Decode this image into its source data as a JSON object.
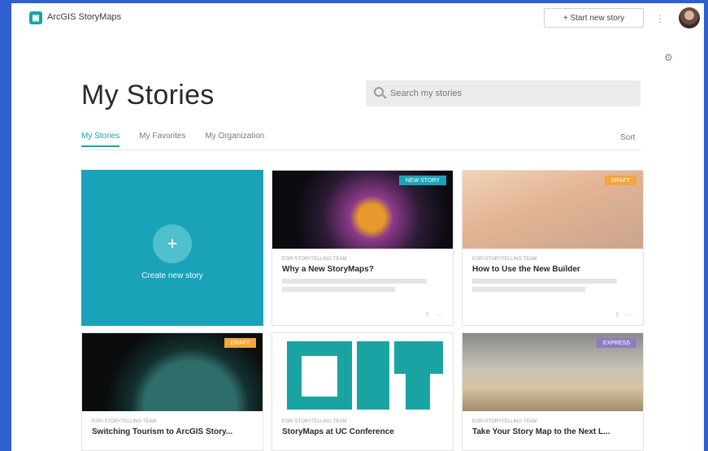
{
  "header": {
    "app_name": "ArcGIS StoryMaps",
    "new_story_label": "+ Start new story",
    "menu_label": "⋮"
  },
  "page": {
    "title": "My Stories",
    "search_placeholder": "Search my stories"
  },
  "tabs": [
    {
      "label": "My Stories",
      "active": true
    },
    {
      "label": "My Favorites",
      "active": false
    },
    {
      "label": "My Organization",
      "active": false
    }
  ],
  "sort_label": "Sort",
  "create_card": {
    "label": "Create new story",
    "plus": "+"
  },
  "cards": [
    {
      "badge": "NEW STORY",
      "badge_color": "#1aa3b8",
      "meta": "ESRI STORYTELLING TEAM",
      "title": "Why a New StoryMaps?",
      "thumb": "space"
    },
    {
      "badge": "DRAFT",
      "badge_color": "#f2a63c",
      "meta": "ESRI STORYTELLING TEAM",
      "title": "How to Use the New Builder",
      "thumb": "sky"
    },
    {
      "badge": "DRAFT",
      "badge_color": "#f2a63c",
      "meta": "ESRI STORYTELLING TEAM",
      "title": "Switching Tourism to ArcGIS Story...",
      "thumb": "earth"
    },
    {
      "badge": "",
      "badge_color": "#1aa3b8",
      "meta": "ESRI STORYTELLING TEAM",
      "title": "StoryMaps at UC Conference",
      "thumb": "teal"
    },
    {
      "badge": "EXPRESS",
      "badge_color": "#8e7cc3",
      "meta": "ESRI STORYTELLING TEAM",
      "title": "Take Your Story Map to the Next L...",
      "thumb": "ruins"
    }
  ],
  "colors": {
    "accent": "#1aa3a3",
    "create_card": "#1aa3b8",
    "background": "#2f5fd0"
  }
}
